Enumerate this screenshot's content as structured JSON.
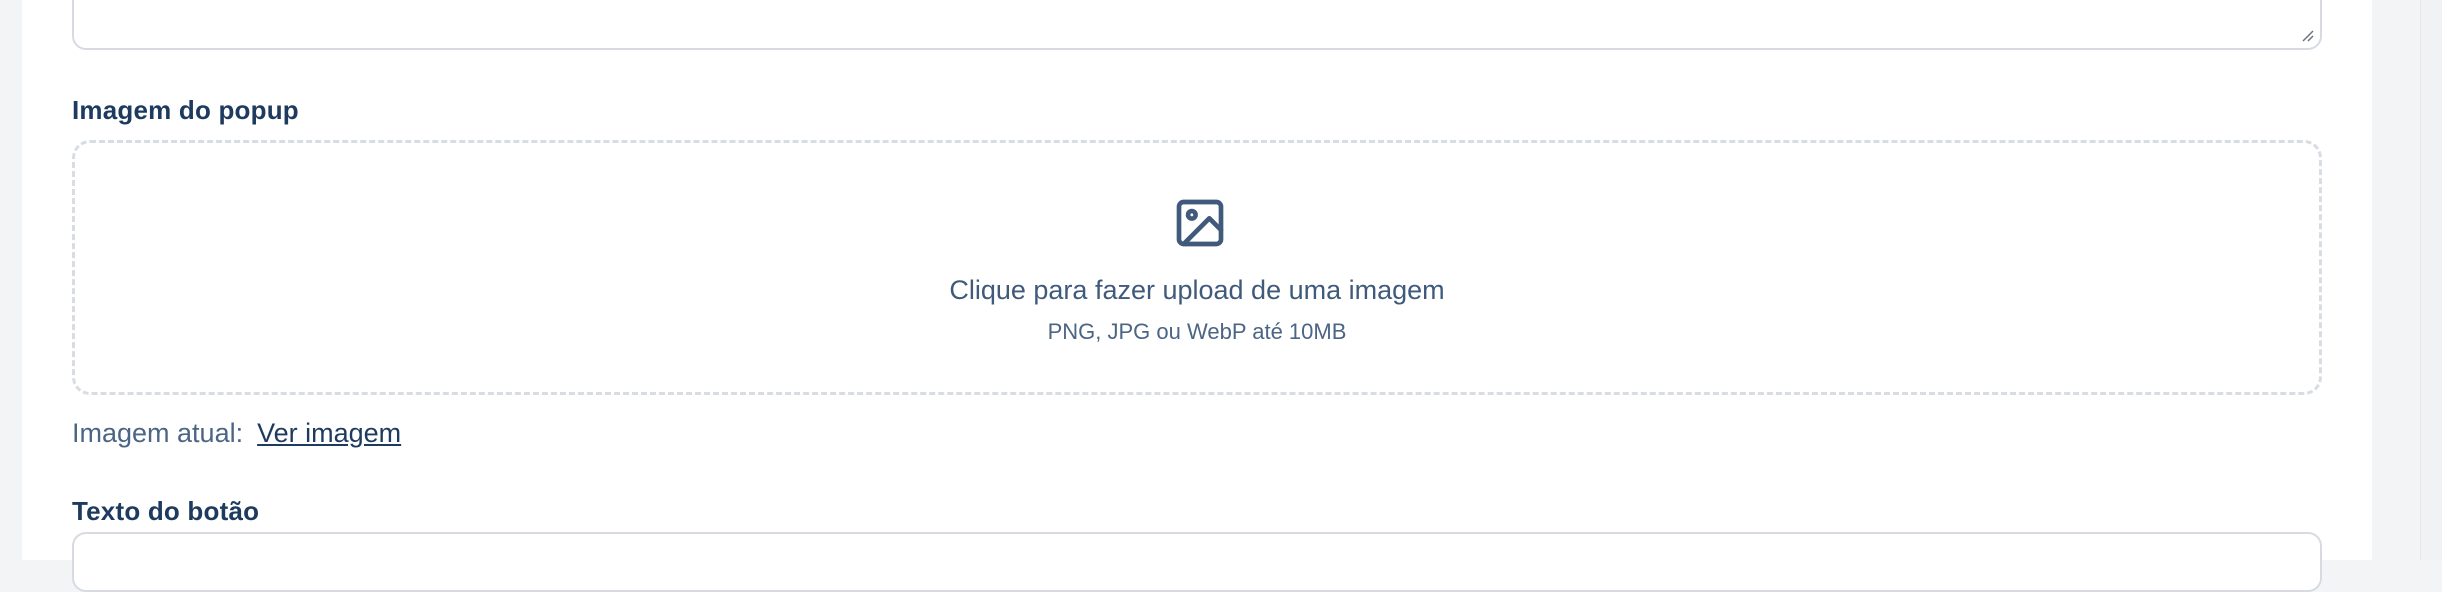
{
  "form": {
    "image_label": "Imagem do popup",
    "upload": {
      "icon": "image-icon",
      "primary_text": "Clique para fazer upload de uma imagem",
      "secondary_text": "PNG, JPG ou WebP até 10MB"
    },
    "current_image": {
      "label": "Imagem atual:",
      "link_text": "Ver imagem"
    },
    "button_text_label": "Texto do botão"
  },
  "colors": {
    "label": "#1e3a5f",
    "muted_text": "#4b6584",
    "border": "#d7dbe1",
    "dashed_border": "#d8dce3"
  }
}
